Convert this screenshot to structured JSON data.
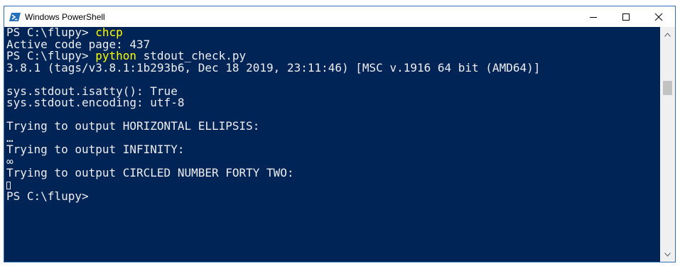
{
  "window": {
    "title": "Windows PowerShell",
    "icon": "powershell-icon",
    "controls": [
      "minimize-icon",
      "maximize-icon",
      "close-icon"
    ]
  },
  "colors": {
    "console_background": "#012456",
    "console_text": "#eeedf0",
    "command_highlight": "#ffff00"
  },
  "console": {
    "line1_prompt": "PS C:\\flupy> ",
    "line1_cmd": "chcp",
    "line2": "Active code page: 437",
    "line3_prompt": "PS C:\\flupy> ",
    "line3_cmd": "python",
    "line3_args": " stdout_check.py",
    "line4": "3.8.1 (tags/v3.8.1:1b293b6, Dec 18 2019, 23:11:46) [MSC v.1916 64 bit (AMD64)]",
    "line6": "sys.stdout.isatty(): True",
    "line7": "sys.stdout.encoding: utf-8",
    "line9": "Trying to output HORIZONTAL ELLIPSIS:",
    "line10": "…",
    "line11": "Trying to output INFINITY:",
    "line12": "∞",
    "line13": "Trying to output CIRCLED NUMBER FORTY TWO:",
    "line15": "PS C:\\flupy>"
  }
}
